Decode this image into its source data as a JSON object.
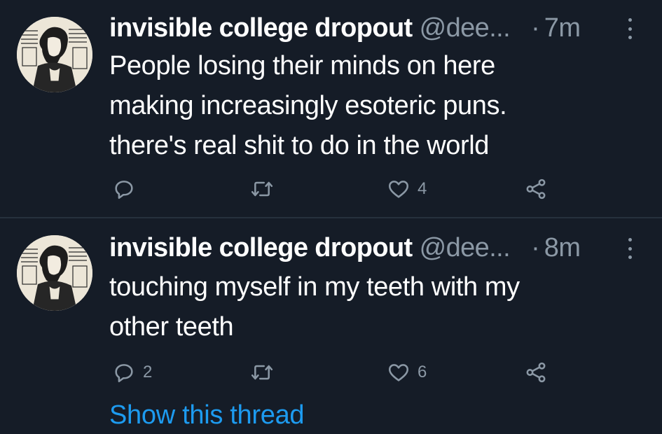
{
  "tweets": [
    {
      "author_name": "invisible college dropout",
      "handle": "@dee...",
      "separator": "·",
      "time": "7m",
      "text": "People losing their minds on here\nmaking increasingly esoteric puns.\nthere's real shit to do in the world",
      "reply_count": "",
      "like_count": "4"
    },
    {
      "author_name": "invisible college dropout",
      "handle": "@dee...",
      "separator": "·",
      "time": "8m",
      "text": "touching myself in my teeth with my\nother teeth",
      "reply_count": "2",
      "like_count": "6"
    }
  ],
  "show_thread_label": "Show this thread",
  "colors": {
    "background": "#151c27",
    "secondary_text": "#8b98a5",
    "link": "#1d9bf0",
    "divider": "#26313d"
  },
  "icons": [
    "reply-icon",
    "retweet-icon",
    "like-icon",
    "share-icon",
    "more-options-icon"
  ]
}
